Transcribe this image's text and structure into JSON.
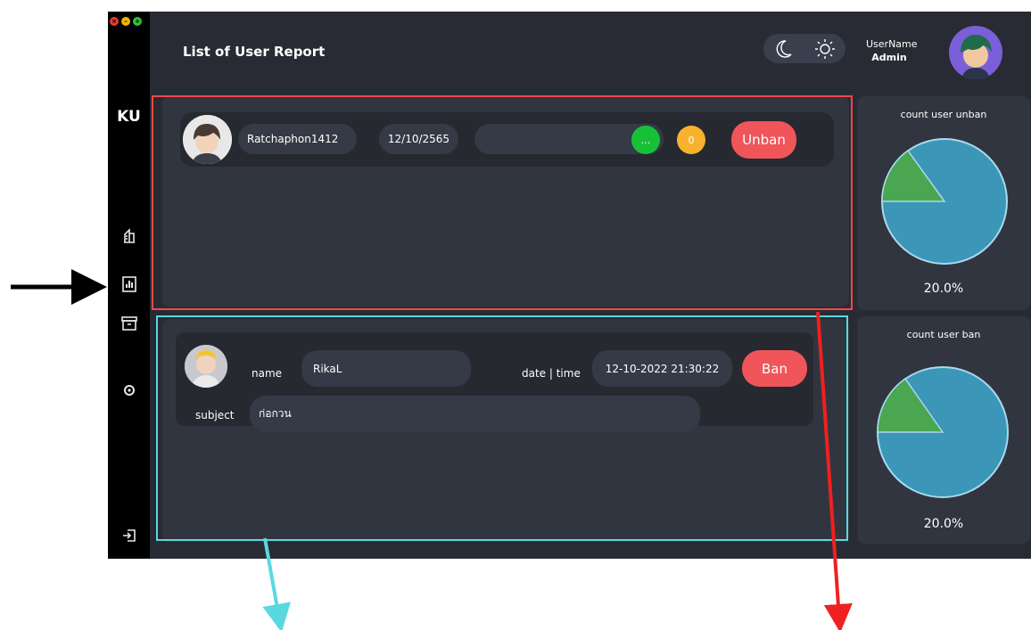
{
  "window": {
    "logo": "KU",
    "title": "List of User Report"
  },
  "user": {
    "label": "UserName",
    "role": "Admin"
  },
  "unban_list": {
    "rows": [
      {
        "username": "Ratchaphon1412",
        "date": "12/10/2565",
        "note": "",
        "more_label": "...",
        "count": "0",
        "action": "Unban"
      }
    ]
  },
  "ban_list": {
    "rows": [
      {
        "name_label": "name",
        "name": "RikaL",
        "datetime_label": "date | time",
        "datetime": "12-10-2022 21:30:22",
        "action": "Ban",
        "subject_label": "subject",
        "subject": "ก่อกวน"
      }
    ]
  },
  "stats": {
    "unban": {
      "title": "count user unban",
      "percent_label": "20.0%",
      "percent_value": 20.0
    },
    "ban": {
      "title": "count user ban",
      "percent_label": "20.0%",
      "percent_value": 20.0
    }
  },
  "colors": {
    "pie_main": "#3b96b8",
    "pie_slice": "#4aa650",
    "red_highlight": "#f04848",
    "cyan_highlight": "#5ad8e0",
    "danger": "#f0555a",
    "ok": "#16c138",
    "warn": "#f8b22e"
  },
  "icons": [
    "close-icon",
    "minimize-icon",
    "maximize-icon",
    "reports-icon",
    "chart-icon",
    "archive-icon",
    "settings-icon",
    "logout-icon",
    "moon-icon",
    "sun-icon"
  ]
}
